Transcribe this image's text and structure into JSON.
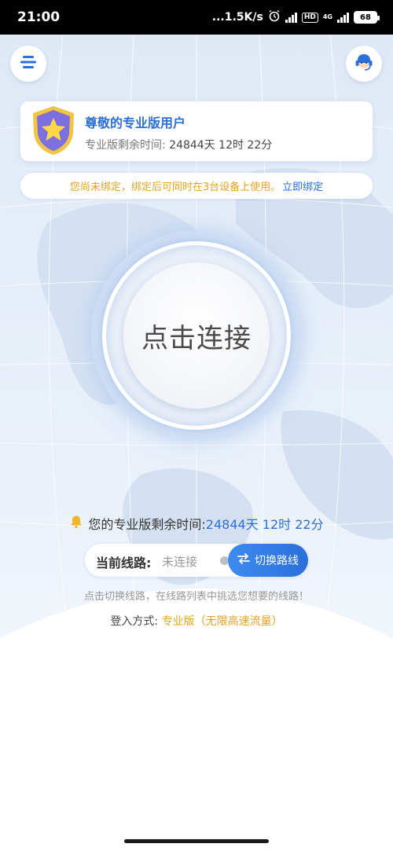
{
  "status_bar": {
    "time": "21:00",
    "net_speed": "...1.5K/s",
    "hd_badge": "HD",
    "network_type": "4G",
    "battery": "68"
  },
  "header": {
    "menu_icon": "menu-lines-icon",
    "support_icon": "customer-service-headset-icon"
  },
  "member_card": {
    "title": "尊敬的专业版用户",
    "remain_label": "专业版剩余时间:",
    "remain_value": "24844天 12时 22分",
    "badge_icon": "star-shield-icon"
  },
  "bind_notice": {
    "text": "您尚未绑定，绑定后可同时在3台设备上使用。",
    "link": "立即绑定"
  },
  "connect": {
    "label": "点击连接"
  },
  "remain_info": {
    "label": "您的专业版剩余时间:",
    "value": "24844天 12时 22分",
    "icon": "bell-icon"
  },
  "route": {
    "label": "当前线路:",
    "status": "未连接",
    "switch_label": "切换路线",
    "switch_icon": "swap-arrows-icon"
  },
  "hint": "点击切换线路，在线路列表中挑选您想要的线路！",
  "login": {
    "label": "登入方式: ",
    "value": "专业版（无限高速流量）"
  },
  "colors": {
    "primary_blue": "#2a6fdb",
    "accent_orange": "#e6a31d",
    "hero_bg": "#e3ecf8"
  }
}
